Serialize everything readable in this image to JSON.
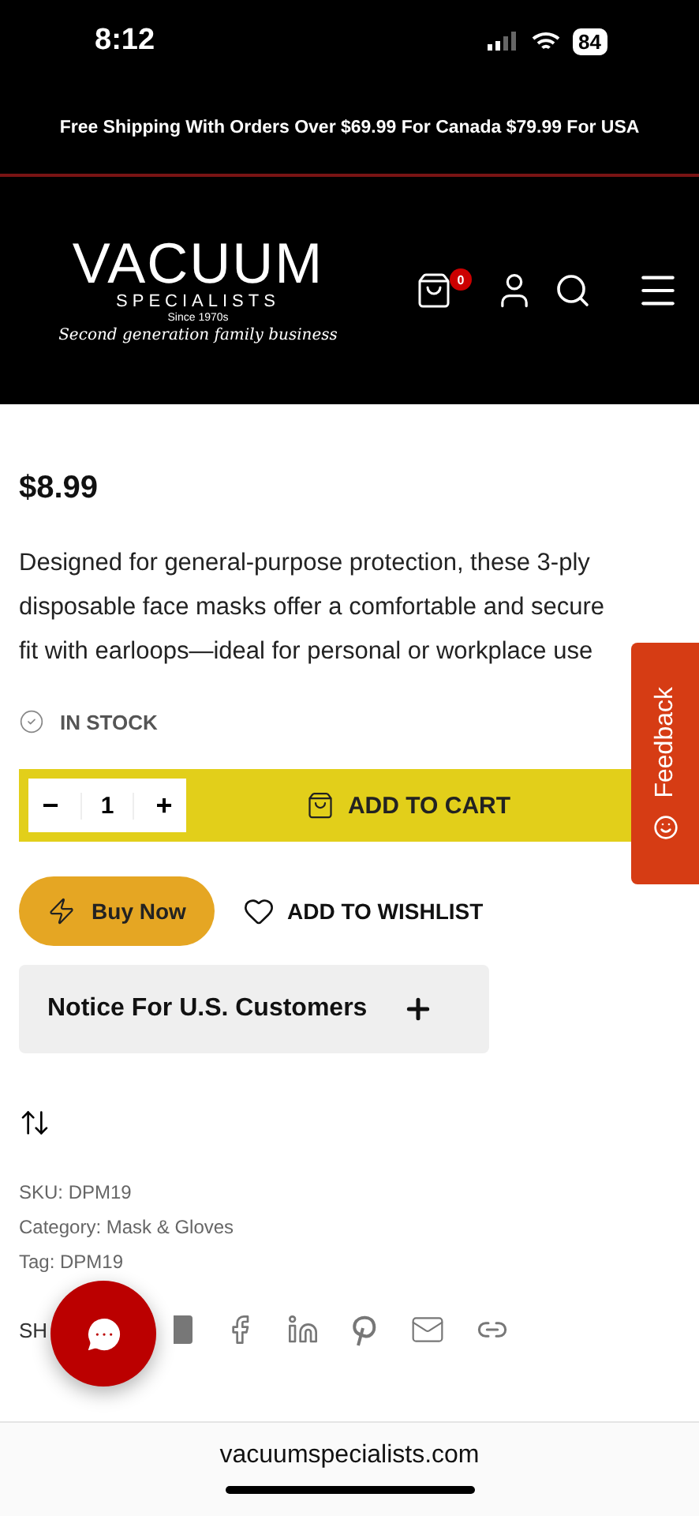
{
  "status_bar": {
    "time": "8:12",
    "battery": "84"
  },
  "promo": "Free Shipping With Orders Over $69.99 For Canada $79.99 For USA",
  "logo": {
    "name": "VACUUM",
    "subtitle": "SPECIALISTS",
    "since": "Since 1970s",
    "tagline": "Second generation family business"
  },
  "cart_count": "0",
  "product": {
    "price": "$8.99",
    "description": "Designed for general-purpose protection, these 3-ply disposable face masks offer a comfortable and secure fit with earloops—ideal for personal or workplace use",
    "stock": "IN STOCK",
    "quantity": "1",
    "minus": "−",
    "plus": "+",
    "add_to_cart": "ADD TO CART",
    "buy_now": "Buy Now",
    "wishlist": "ADD TO WISHLIST"
  },
  "notice": {
    "title": "Notice For U.S. Customers",
    "expanded": false
  },
  "meta": [
    "SKU: DPM19",
    "Category: Mask & Gloves",
    "Tag: DPM19"
  ],
  "share_label": "SH",
  "feedback": "Feedback",
  "url": "vacuumspecialists.com"
}
